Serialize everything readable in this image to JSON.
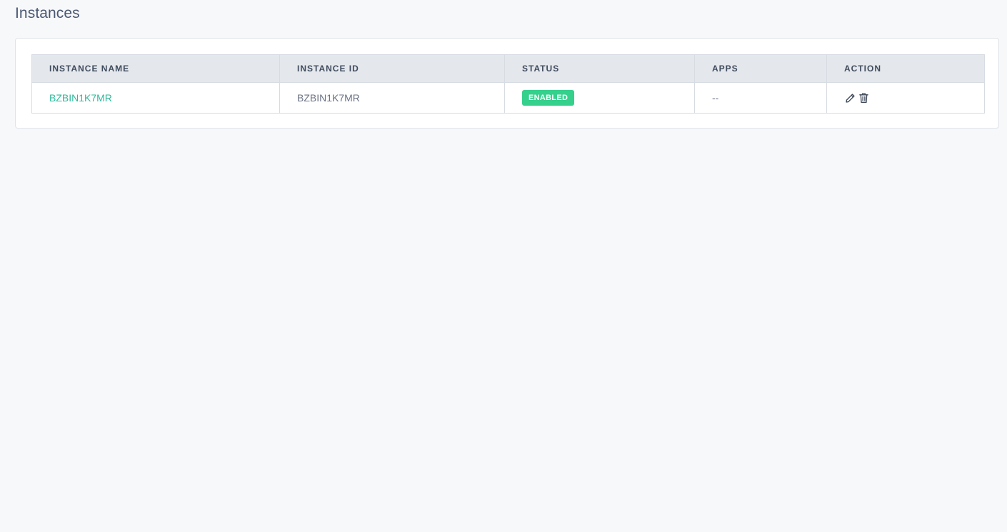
{
  "page": {
    "title": "Instances"
  },
  "table": {
    "headers": [
      "INSTANCE NAME",
      "INSTANCE ID",
      "STATUS",
      "APPS",
      "ACTION"
    ],
    "rows": [
      {
        "instance_name": "BZBIN1K7MR",
        "instance_id": "BZBIN1K7MR",
        "status": "ENABLED",
        "apps": "--",
        "actions": [
          {
            "icon": "pencil-icon"
          },
          {
            "icon": "trash-icon"
          }
        ]
      }
    ]
  },
  "colors": {
    "link": "#2fb99a",
    "status_enabled": "#34d08c",
    "header_bg": "#e4e7ec",
    "page_bg": "#f7f8fa"
  }
}
